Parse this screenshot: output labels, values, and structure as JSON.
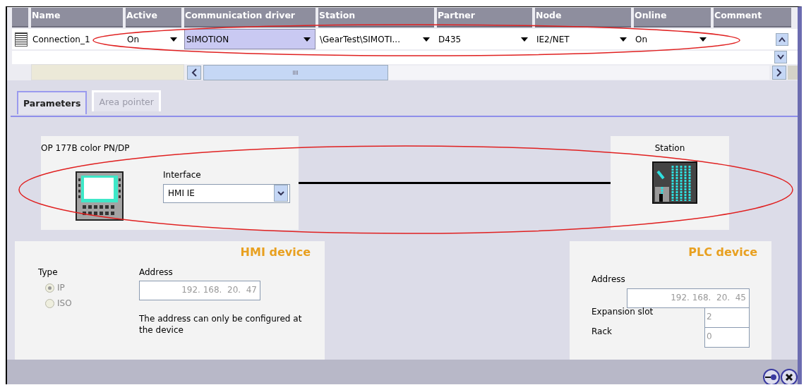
{
  "table": {
    "columns": [
      "Name",
      "Active",
      "Communication driver",
      "Station",
      "Partner",
      "Node",
      "Online",
      "Comment"
    ],
    "rows": [
      {
        "cells": [
          {
            "kind": "text",
            "text": "Connection_1",
            "selected": false
          },
          {
            "kind": "dropdown",
            "text": "On",
            "selected": false
          },
          {
            "kind": "dropdown",
            "text": "SIMOTION",
            "selected": true
          },
          {
            "kind": "dropdown",
            "text": "\\GearTest\\SIMOTI...",
            "selected": false
          },
          {
            "kind": "dropdown",
            "text": "D435",
            "selected": false
          },
          {
            "kind": "dropdown",
            "text": "IE2/NET",
            "selected": false
          },
          {
            "kind": "dropdown",
            "text": "On",
            "selected": false
          }
        ]
      }
    ]
  },
  "tabs": [
    {
      "label": "Parameters",
      "selected": true
    },
    {
      "label": "Area pointer",
      "selected": false
    }
  ],
  "diagram": {
    "hmi_name": "OP 177B color PN/DP",
    "interface_label": "Interface",
    "interface_value": "HMI IE",
    "station_label": "Station"
  },
  "hmi_device": {
    "title": "HMI device",
    "type_label": "Type",
    "types": [
      {
        "label": "IP",
        "selected": true
      },
      {
        "label": "ISO",
        "selected": false
      }
    ],
    "address_label": "Address",
    "address": "192. 168.  20.  47",
    "note": "The address can only be configured at the device"
  },
  "plc_device": {
    "title": "PLC device",
    "address_label": "Address",
    "address": "192. 168.  20.  45",
    "fields": [
      {
        "label": "Expansion slot",
        "value": "2"
      },
      {
        "label": "Rack",
        "value": "0"
      }
    ]
  },
  "footer": {
    "buttons": [
      {
        "kind": "pin"
      },
      {
        "kind": "close"
      }
    ]
  },
  "annotations": [
    {
      "kind": "ellipse"
    },
    {
      "kind": "ellipse"
    }
  ]
}
